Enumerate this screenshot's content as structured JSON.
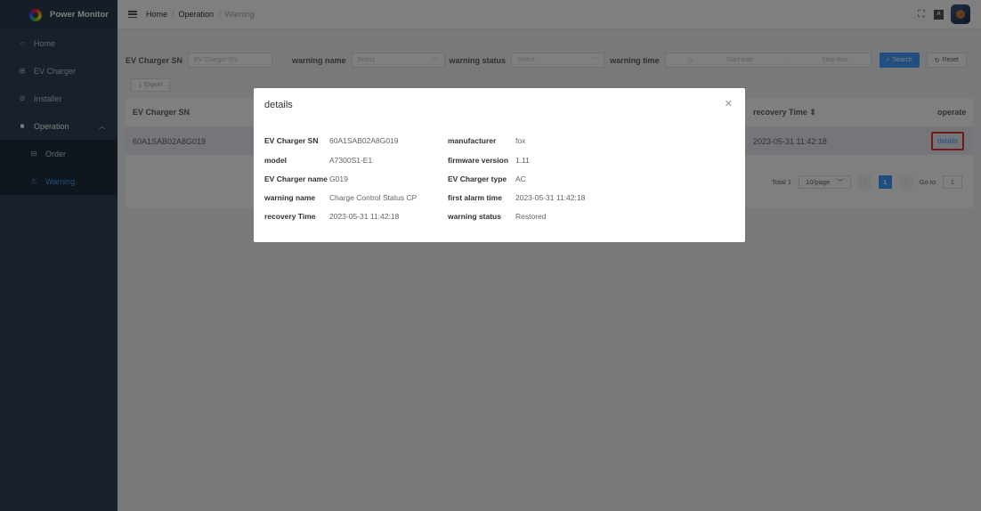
{
  "app": {
    "title": "Power Monitor"
  },
  "sidebar": {
    "items": [
      {
        "label": "Home",
        "icon": "home-icon"
      },
      {
        "label": "EV Charger",
        "icon": "charger-icon"
      },
      {
        "label": "Installer",
        "icon": "installer-icon"
      },
      {
        "label": "Operation",
        "icon": "operation-icon",
        "expanded": true
      },
      {
        "label": "Order",
        "icon": "order-icon"
      },
      {
        "label": "Warning",
        "icon": "warning-icon",
        "selected": true
      }
    ]
  },
  "header": {
    "breadcrumb": [
      "Home",
      "Operation",
      "Warning"
    ]
  },
  "filters": {
    "sn_label": "EV Charger SN",
    "sn_placeholder": "EV Charger SN",
    "name_label": "warning name",
    "name_placeholder": "Select",
    "status_label": "warning status",
    "status_placeholder": "Select",
    "time_label": "warning time",
    "start_placeholder": "Start date",
    "range_sep": "-",
    "stop_placeholder": "Stop date",
    "search_label": "Search",
    "reset_label": "Reset",
    "export_label": "Export"
  },
  "table": {
    "headers": {
      "sn": "EV Charger SN",
      "recovery": "recovery Time",
      "operate": "operate"
    },
    "rows": [
      {
        "sn": "60A1SAB02A8G019",
        "recovery": "2023-05-31 11:42:18",
        "action": "details"
      }
    ]
  },
  "pagination": {
    "total": "Total 1",
    "page_size": "10/page",
    "current": "1",
    "goto_label": "Go to",
    "goto_value": "1"
  },
  "modal": {
    "title": "details",
    "fields": [
      {
        "key": "EV Charger SN",
        "value": "60A1SAB02A8G019"
      },
      {
        "key": "manufacturer",
        "value": "fox"
      },
      {
        "key": "model",
        "value": "A7300S1-E1"
      },
      {
        "key": "firmware version",
        "value": "1.11"
      },
      {
        "key": "EV Charger name",
        "value": "G019"
      },
      {
        "key": "EV Charger type",
        "value": "AC"
      },
      {
        "key": "warning name",
        "value": "Charge Control Status CP"
      },
      {
        "key": "first alarm time",
        "value": "2023-05-31 11:42:18"
      },
      {
        "key": "recovery Time",
        "value": "2023-05-31 11:42:18"
      },
      {
        "key": "warning status",
        "value": "Restored"
      }
    ]
  }
}
